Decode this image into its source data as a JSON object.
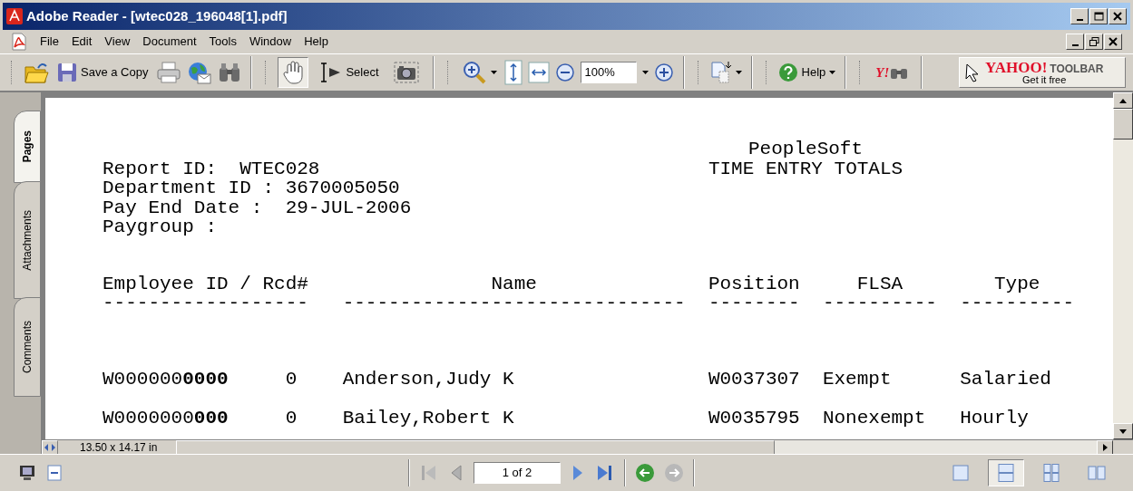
{
  "window": {
    "title": "Adobe Reader - [wtec028_196048[1].pdf]"
  },
  "menu": [
    "File",
    "Edit",
    "View",
    "Document",
    "Tools",
    "Window",
    "Help"
  ],
  "toolbar": {
    "save_label": "Save a Copy",
    "tools": [
      {
        "kind": "hand",
        "selected": true
      },
      {
        "kind": "select",
        "label": "Select",
        "selected": false
      },
      {
        "kind": "snapshot",
        "selected": false
      }
    ],
    "zoom_value": "100%",
    "help_label": "Help",
    "yahoo_logo": "Y!",
    "yahoo_toolbar": {
      "title": "YAHOO!",
      "subtitle": "TOOLBAR",
      "cta": "Get it free"
    }
  },
  "nav_tabs": [
    {
      "label": "Pages",
      "selected": true
    },
    {
      "label": "Attachments",
      "selected": false
    },
    {
      "label": "Comments",
      "selected": false
    }
  ],
  "report": {
    "app": "PeopleSoft",
    "title": "TIME ENTRY TOTALS",
    "fields": [
      "Report ID:  WTEC028",
      "Department ID : 3670005050",
      "Pay End Date :  29-JUL-2006",
      "Paygroup :"
    ],
    "columns": [
      {
        "label": "Employee ID / Rcd#",
        "rule": "------------------"
      },
      {
        "label": "Name",
        "rule": "------------------------------"
      },
      {
        "label": "Position",
        "rule": "--------"
      },
      {
        "label": "FLSA",
        "rule": "----------"
      },
      {
        "label": "Type",
        "rule": "----------"
      }
    ],
    "rows": [
      {
        "employee_id": "W000000**0000**",
        "rcd": "0",
        "name": "Anderson,Judy K",
        "position": "W0037307",
        "flsa": "Exempt",
        "type": "Salaried"
      },
      {
        "employee_id": "W0000000**000**",
        "rcd": "0",
        "name": "Bailey,Robert K",
        "position": "W0035795",
        "flsa": "Nonexempt",
        "type": "Hourly"
      }
    ]
  },
  "status": {
    "page_size": "13.50 x 14.17 in",
    "page_field": "1 of 2",
    "view_modes": [
      {
        "kind": "single",
        "selected": false
      },
      {
        "kind": "continuous",
        "selected": true
      },
      {
        "kind": "continuous-facing",
        "selected": false
      },
      {
        "kind": "facing",
        "selected": false
      }
    ]
  }
}
